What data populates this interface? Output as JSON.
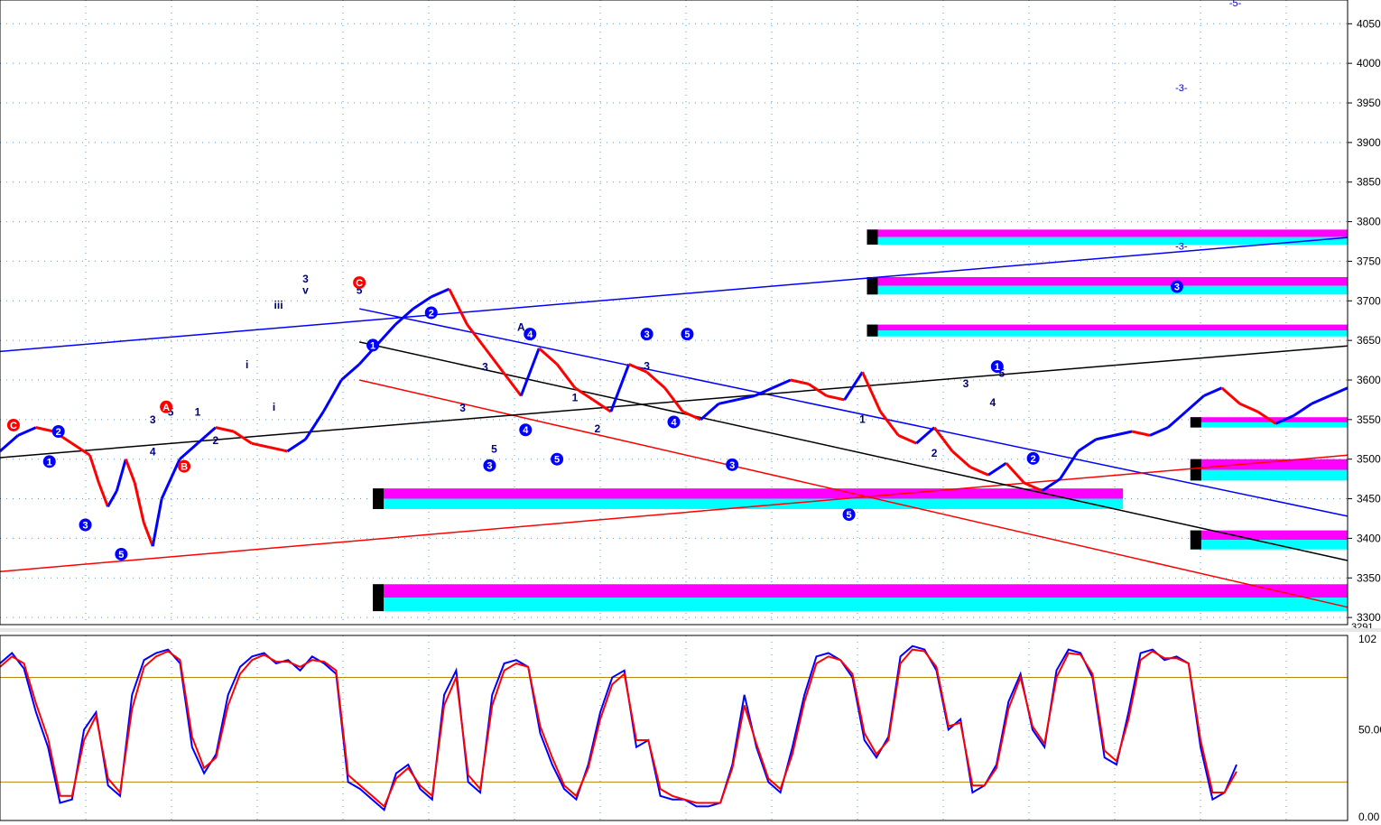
{
  "colors": {
    "up": "#0000ff",
    "down": "#ff0000",
    "neutral": "#000000",
    "cyan": "#00ffff",
    "magenta": "#ff00ff",
    "sma": "#b4cdb4",
    "grid": "#5a9bd5",
    "axis_bg": "#ffffff"
  },
  "chart_data": [
    {
      "type": "line",
      "title": "",
      "ylim": [
        3291,
        4080
      ],
      "grid": true,
      "y_ticks": [
        {
          "v": 4050,
          "label": "4050"
        },
        {
          "v": 4000,
          "label": "4000"
        },
        {
          "v": 3950,
          "label": "3950"
        },
        {
          "v": 3900,
          "label": "3900"
        },
        {
          "v": 3850,
          "label": "3850"
        },
        {
          "v": 3800,
          "label": "3800"
        },
        {
          "v": 3750,
          "label": "3750"
        },
        {
          "v": 3700,
          "label": "3700"
        },
        {
          "v": 3650,
          "label": "3650"
        },
        {
          "v": 3600,
          "label": "3600"
        },
        {
          "v": 3550,
          "label": "3550"
        },
        {
          "v": 3500,
          "label": "3500"
        },
        {
          "v": 3450,
          "label": "3450"
        },
        {
          "v": 3400,
          "label": "3400"
        },
        {
          "v": 3350,
          "label": "3350"
        },
        {
          "v": 3300,
          "label": "3300"
        }
      ],
      "y_min_label": "3291",
      "x_range": [
        0,
        300
      ],
      "price": [
        [
          0,
          3510
        ],
        [
          4,
          3530
        ],
        [
          8,
          3540
        ],
        [
          12,
          3535
        ],
        [
          16,
          3520
        ],
        [
          20,
          3505
        ],
        [
          22,
          3470
        ],
        [
          24,
          3440
        ],
        [
          26,
          3460
        ],
        [
          28,
          3500
        ],
        [
          30,
          3470
        ],
        [
          32,
          3420
        ],
        [
          34,
          3390
        ],
        [
          36,
          3450
        ],
        [
          40,
          3500
        ],
        [
          44,
          3520
        ],
        [
          48,
          3540
        ],
        [
          52,
          3535
        ],
        [
          56,
          3520
        ],
        [
          60,
          3515
        ],
        [
          64,
          3510
        ],
        [
          68,
          3525
        ],
        [
          72,
          3560
        ],
        [
          76,
          3600
        ],
        [
          80,
          3620
        ],
        [
          84,
          3645
        ],
        [
          88,
          3670
        ],
        [
          92,
          3690
        ],
        [
          96,
          3705
        ],
        [
          100,
          3715
        ],
        [
          104,
          3670
        ],
        [
          108,
          3640
        ],
        [
          112,
          3610
        ],
        [
          116,
          3580
        ],
        [
          120,
          3640
        ],
        [
          124,
          3620
        ],
        [
          128,
          3590
        ],
        [
          132,
          3575
        ],
        [
          136,
          3560
        ],
        [
          140,
          3620
        ],
        [
          144,
          3610
        ],
        [
          148,
          3590
        ],
        [
          152,
          3560
        ],
        [
          156,
          3550
        ],
        [
          160,
          3570
        ],
        [
          164,
          3575
        ],
        [
          168,
          3580
        ],
        [
          172,
          3590
        ],
        [
          176,
          3600
        ],
        [
          180,
          3595
        ],
        [
          184,
          3580
        ],
        [
          188,
          3575
        ],
        [
          192,
          3610
        ],
        [
          196,
          3560
        ],
        [
          200,
          3530
        ],
        [
          204,
          3520
        ],
        [
          208,
          3540
        ],
        [
          212,
          3510
        ],
        [
          216,
          3490
        ],
        [
          220,
          3480
        ],
        [
          224,
          3495
        ],
        [
          228,
          3470
        ],
        [
          232,
          3460
        ],
        [
          236,
          3475
        ],
        [
          240,
          3510
        ],
        [
          244,
          3525
        ],
        [
          248,
          3530
        ],
        [
          252,
          3535
        ],
        [
          256,
          3530
        ],
        [
          260,
          3540
        ],
        [
          264,
          3560
        ],
        [
          268,
          3580
        ],
        [
          272,
          3590
        ],
        [
          276,
          3570
        ],
        [
          280,
          3560
        ],
        [
          284,
          3545
        ],
        [
          288,
          3555
        ],
        [
          292,
          3570
        ],
        [
          296,
          3580
        ],
        [
          300,
          3590
        ]
      ],
      "x_axis": {
        "direction": "increasing",
        "bars": 300
      },
      "channel_lines": [
        {
          "name": "",
          "color": "#0000ff",
          "p1": [
            0,
            3636
          ],
          "p2": [
            300,
            3780
          ]
        },
        {
          "name": "",
          "color": "#0000ff",
          "p1": [
            80,
            3690
          ],
          "p2": [
            300,
            3428
          ]
        },
        {
          "name": "",
          "color": "#ff0000",
          "p1": [
            0,
            3358
          ],
          "p2": [
            300,
            3505
          ]
        },
        {
          "name": "",
          "color": "#ff0000",
          "p1": [
            80,
            3600
          ],
          "p2": [
            300,
            3313
          ]
        },
        {
          "name": "",
          "color": "#000000",
          "p1": [
            0,
            3502
          ],
          "p2": [
            300,
            3643
          ]
        },
        {
          "name": "",
          "color": "#000000",
          "p1": [
            80,
            3648
          ],
          "p2": [
            300,
            3372
          ]
        }
      ],
      "zones": [
        {
          "from_x": 83,
          "to_x": 250,
          "lo": 3437,
          "hi": 3463
        },
        {
          "from_x": 83,
          "to_x": 300,
          "lo": 3308,
          "hi": 3342
        },
        {
          "from_x": 193,
          "to_x": 300,
          "lo": 3771,
          "hi": 3790
        },
        {
          "from_x": 193,
          "to_x": 300,
          "lo": 3708,
          "hi": 3730
        },
        {
          "from_x": 193,
          "to_x": 300,
          "lo": 3655,
          "hi": 3670
        },
        {
          "from_x": 265,
          "to_x": 300,
          "lo": 3540,
          "hi": 3553
        },
        {
          "from_x": 265,
          "to_x": 300,
          "lo": 3473,
          "hi": 3500
        },
        {
          "from_x": 265,
          "to_x": 300,
          "lo": 3386,
          "hi": 3410
        }
      ],
      "wave_labels_text": [
        {
          "x": 68,
          "v": 3723,
          "text": "3"
        },
        {
          "x": 68,
          "v": 3709,
          "text": "v"
        },
        {
          "x": 80,
          "v": 3709,
          "text": "5"
        },
        {
          "x": 62,
          "v": 3690,
          "text": "iii"
        },
        {
          "x": 61,
          "v": 3561,
          "text": "i"
        },
        {
          "x": 55,
          "v": 3615,
          "text": "i"
        },
        {
          "x": 48,
          "v": 3519,
          "text": "2"
        },
        {
          "x": 34,
          "v": 3545,
          "text": "3"
        },
        {
          "x": 38,
          "v": 3555,
          "text": "5"
        },
        {
          "x": 44,
          "v": 3555,
          "text": "1"
        },
        {
          "x": 34,
          "v": 3505,
          "text": "4"
        },
        {
          "x": 108,
          "v": 3612,
          "text": "3"
        },
        {
          "x": 103,
          "v": 3560,
          "text": "3"
        },
        {
          "x": 110,
          "v": 3508,
          "text": "5"
        },
        {
          "x": 144,
          "v": 3613,
          "text": "3"
        },
        {
          "x": 128,
          "v": 3573,
          "text": "1"
        },
        {
          "x": 133,
          "v": 3534,
          "text": "2"
        },
        {
          "x": 192,
          "v": 3546,
          "text": "1"
        },
        {
          "x": 223,
          "v": 3604,
          "text": "5"
        },
        {
          "x": 215,
          "v": 3591,
          "text": "3"
        },
        {
          "x": 221,
          "v": 3567,
          "text": "4"
        },
        {
          "x": 208,
          "v": 3503,
          "text": "2"
        },
        {
          "x": 116,
          "v": 3662,
          "text": "A"
        }
      ],
      "wave_labels_circle": [
        {
          "x": 80,
          "v": 3723,
          "text": "C",
          "color": "#ff0000"
        },
        {
          "x": 3,
          "v": 3543,
          "text": "C",
          "color": "#ff0000"
        },
        {
          "x": 37,
          "v": 3566,
          "text": "A",
          "color": "#ff0000"
        },
        {
          "x": 41,
          "v": 3491,
          "text": "B",
          "color": "#ff0000"
        },
        {
          "x": 13,
          "v": 3535,
          "text": "2",
          "color": "#0000ff"
        },
        {
          "x": 11,
          "v": 3497,
          "text": "1",
          "color": "#0000ff"
        },
        {
          "x": 19,
          "v": 3417,
          "text": "3",
          "color": "#0000ff"
        },
        {
          "x": 27,
          "v": 3380,
          "text": "5",
          "color": "#0000ff"
        },
        {
          "x": 83,
          "v": 3644,
          "text": "1",
          "color": "#0000ff"
        },
        {
          "x": 96,
          "v": 3685,
          "text": "2",
          "color": "#0000ff"
        },
        {
          "x": 109,
          "v": 3492,
          "text": "3",
          "color": "#0000ff"
        },
        {
          "x": 117,
          "v": 3537,
          "text": "4",
          "color": "#0000ff"
        },
        {
          "x": 124,
          "v": 3500,
          "text": "5",
          "color": "#0000ff"
        },
        {
          "x": 118,
          "v": 3658,
          "text": "4",
          "color": "#0000ff"
        },
        {
          "x": 144,
          "v": 3658,
          "text": "3",
          "color": "#0000ff"
        },
        {
          "x": 153,
          "v": 3658,
          "text": "5",
          "color": "#0000ff"
        },
        {
          "x": 150,
          "v": 3547,
          "text": "4",
          "color": "#0000ff"
        },
        {
          "x": 163,
          "v": 3493,
          "text": "3",
          "color": "#0000ff"
        },
        {
          "x": 189,
          "v": 3430,
          "text": "5",
          "color": "#0000ff"
        },
        {
          "x": 222,
          "v": 3617,
          "text": "1",
          "color": "#0000ff"
        },
        {
          "x": 230,
          "v": 3501,
          "text": "2",
          "color": "#0000ff"
        },
        {
          "x": 262,
          "v": 3718,
          "text": "3",
          "color": "#0000ff"
        }
      ],
      "top_labels": [
        {
          "x": 275,
          "v": 4072,
          "text": "-5-"
        },
        {
          "x": 263,
          "v": 3965,
          "text": "-3-"
        },
        {
          "x": 263,
          "v": 3765,
          "text": "-3-"
        }
      ]
    },
    {
      "type": "line",
      "title": "",
      "ylim": [
        0,
        102
      ],
      "y_ticks": [
        {
          "v": 102,
          "label": "102"
        },
        {
          "v": 50,
          "label": "50.00"
        },
        {
          "v": 0,
          "label": "0.00"
        }
      ],
      "reference_lines": [
        80,
        20
      ],
      "series": [
        {
          "color": "#0000ff",
          "values": [
            88,
            94,
            85,
            60,
            40,
            8,
            10,
            50,
            60,
            18,
            12,
            70,
            90,
            94,
            96,
            88,
            40,
            25,
            36,
            70,
            86,
            92,
            94,
            88,
            90,
            84,
            92,
            88,
            82,
            20,
            16,
            10,
            4,
            25,
            30,
            16,
            10,
            70,
            84,
            20,
            14,
            70,
            88,
            90,
            86,
            48,
            30,
            16,
            10,
            30,
            60,
            80,
            84,
            40,
            44,
            12,
            10,
            10,
            6,
            6,
            8,
            30,
            70,
            40,
            20,
            14,
            40,
            70,
            92,
            94,
            90,
            80,
            44,
            34,
            46,
            92,
            98,
            96,
            84,
            50,
            56,
            14,
            18,
            30,
            66,
            82,
            50,
            40,
            84,
            96,
            94,
            80,
            34,
            30,
            60,
            94,
            96,
            90,
            92,
            88,
            40,
            10,
            14,
            30
          ]
        },
        {
          "color": "#ff0000",
          "values": [
            86,
            92,
            88,
            65,
            45,
            12,
            12,
            44,
            58,
            22,
            14,
            62,
            86,
            92,
            95,
            90,
            46,
            28,
            34,
            64,
            82,
            90,
            93,
            89,
            89,
            86,
            90,
            89,
            84,
            24,
            18,
            12,
            6,
            22,
            28,
            18,
            12,
            64,
            80,
            24,
            16,
            64,
            84,
            88,
            86,
            52,
            34,
            18,
            12,
            28,
            56,
            76,
            82,
            44,
            44,
            16,
            12,
            10,
            8,
            8,
            8,
            28,
            64,
            42,
            22,
            16,
            36,
            66,
            88,
            92,
            90,
            82,
            48,
            36,
            44,
            88,
            96,
            95,
            86,
            52,
            54,
            18,
            18,
            28,
            62,
            80,
            52,
            42,
            80,
            94,
            93,
            82,
            38,
            32,
            56,
            90,
            95,
            91,
            91,
            88,
            44,
            14,
            14,
            26
          ]
        }
      ]
    }
  ]
}
